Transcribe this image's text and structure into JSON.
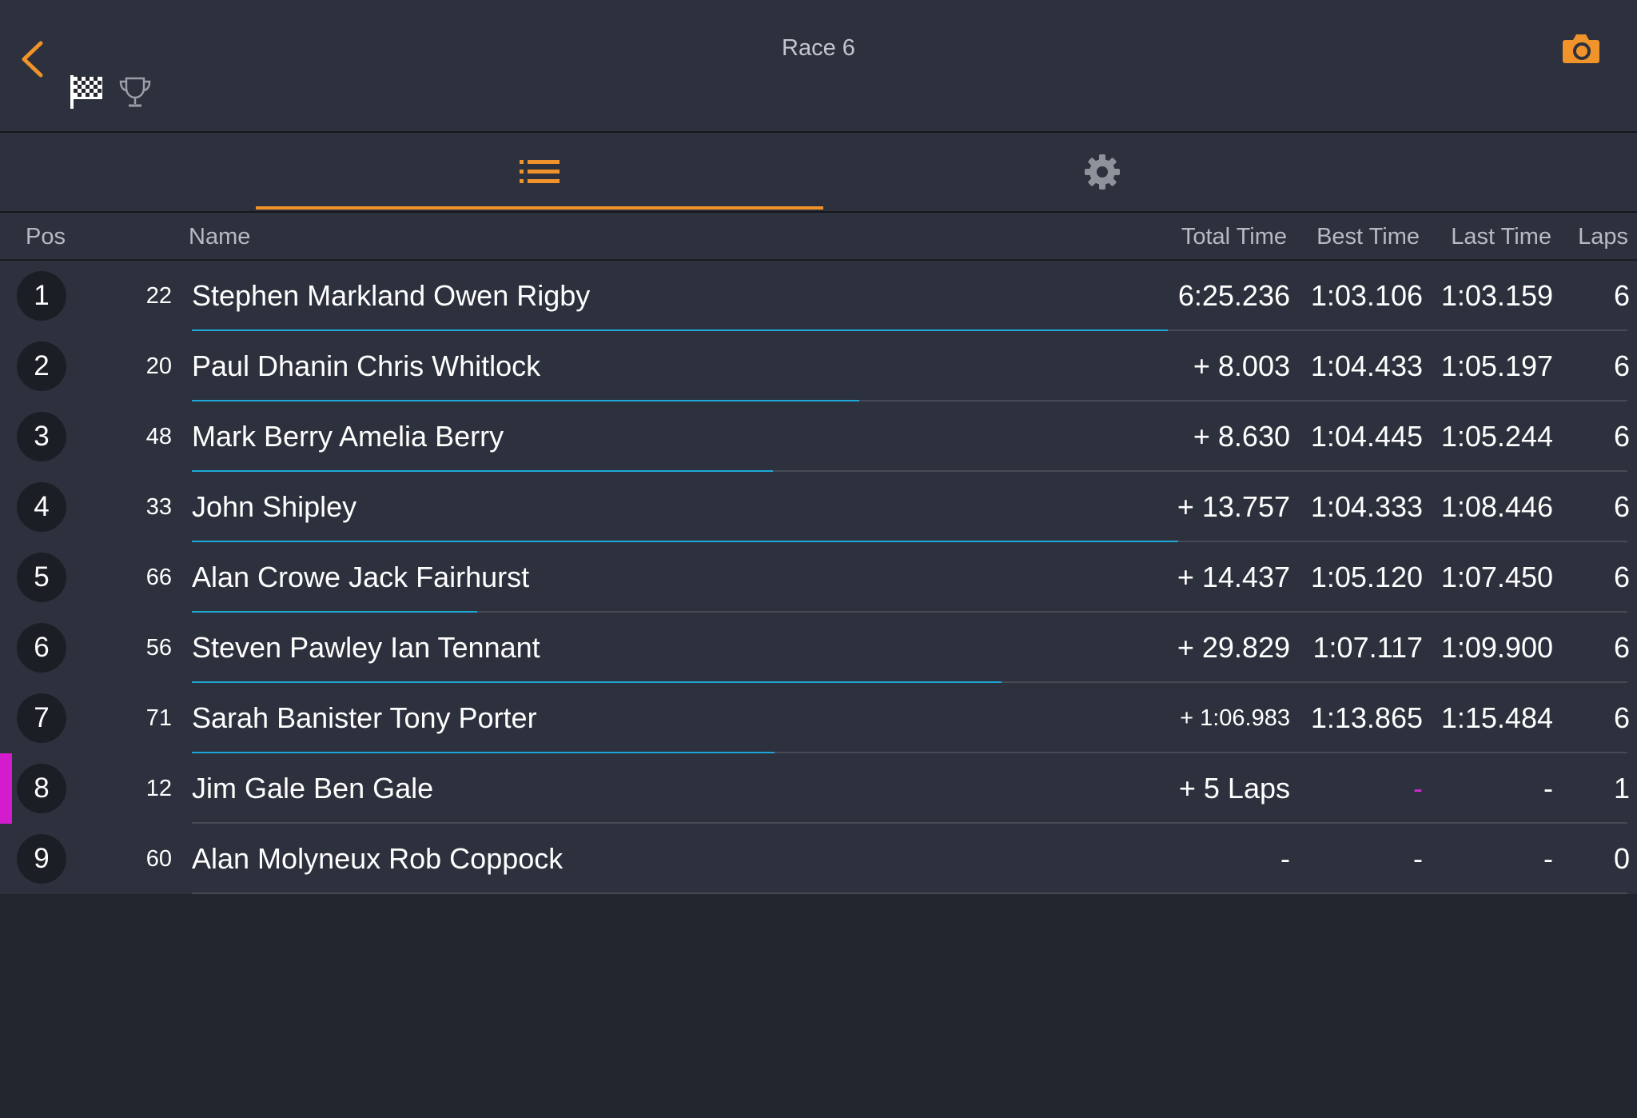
{
  "header": {
    "title": "Race 6"
  },
  "icons": {
    "back": "chevron-left-icon",
    "flag": "checkered-flag-icon",
    "trophy": "trophy-icon",
    "camera": "camera-icon",
    "list": "list-icon",
    "settings": "gear-icon"
  },
  "colors": {
    "accent": "#f0932a",
    "progress": "#1ea8d8",
    "highlight": "#d41ccf",
    "background": "#2c313d"
  },
  "columns": {
    "pos": "Pos",
    "name": "Name",
    "total": "Total Time",
    "best": "Best Time",
    "last": "Last Time",
    "laps": "Laps"
  },
  "rows": [
    {
      "pos": "1",
      "num": "22",
      "name": "Stephen Markland Owen Rigby",
      "total": "6:25.236",
      "best": "1:03.106",
      "last": "1:03.159",
      "laps": "6",
      "progress": 0.68
    },
    {
      "pos": "2",
      "num": "20",
      "name": "Paul Dhanin Chris Whitlock",
      "total": "+ 8.003",
      "best": "1:04.433",
      "last": "1:05.197",
      "laps": "6",
      "progress": 0.465
    },
    {
      "pos": "3",
      "num": "48",
      "name": "Mark Berry Amelia Berry",
      "total": "+ 8.630",
      "best": "1:04.445",
      "last": "1:05.244",
      "laps": "6",
      "progress": 0.405
    },
    {
      "pos": "4",
      "num": "33",
      "name": "John Shipley",
      "total": "+ 13.757",
      "best": "1:04.333",
      "last": "1:08.446",
      "laps": "6",
      "progress": 0.687
    },
    {
      "pos": "5",
      "num": "66",
      "name": "Alan Crowe Jack Fairhurst",
      "total": "+ 14.437",
      "best": "1:05.120",
      "last": "1:07.450",
      "laps": "6",
      "progress": 0.199
    },
    {
      "pos": "6",
      "num": "56",
      "name": "Steven Pawley Ian Tennant",
      "total": "+ 29.829",
      "best": "1:07.117",
      "last": "1:09.900",
      "laps": "6",
      "progress": 0.564
    },
    {
      "pos": "7",
      "num": "71",
      "name": "Sarah Banister Tony Porter",
      "total": "+ 1:06.983",
      "best": "1:13.865",
      "last": "1:15.484",
      "laps": "6",
      "progress": 0.406
    },
    {
      "pos": "8",
      "num": "12",
      "name": "Jim Gale Ben Gale",
      "total": "+ 5 Laps",
      "best": "-",
      "last": "-",
      "laps": "1",
      "progress": 0,
      "marker": true,
      "bestPurple": true
    },
    {
      "pos": "9",
      "num": "60",
      "name": "Alan Molyneux Rob Coppock",
      "total": "-",
      "best": "-",
      "last": "-",
      "laps": "0",
      "progress": 0
    }
  ]
}
